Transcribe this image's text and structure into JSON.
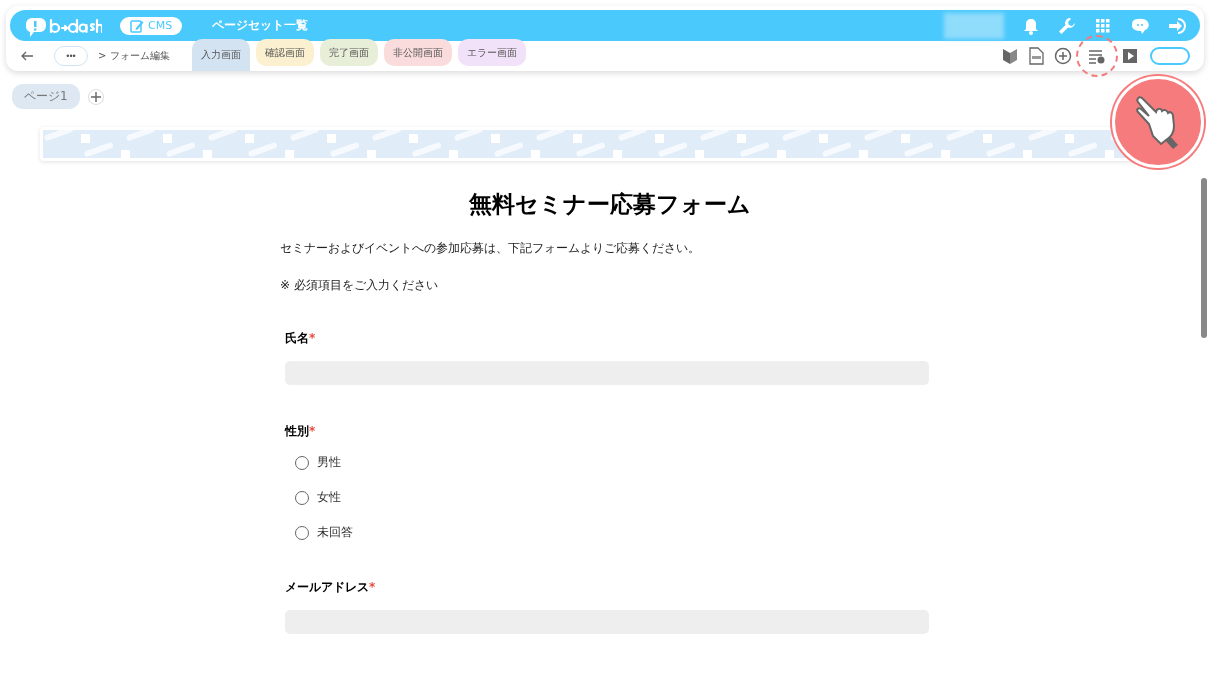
{
  "app_bar": {
    "product": "CMS",
    "title": "ページセット一覧"
  },
  "toolbar": {
    "more": "•••",
    "breadcrumb": "> フォーム編集",
    "tabs": [
      {
        "label": "入力画面",
        "selected": true,
        "color": "#d3e3f2"
      },
      {
        "label": "確認画面",
        "selected": false,
        "color": "#fbf0cf"
      },
      {
        "label": "完了画面",
        "selected": false,
        "color": "#e8efd9"
      },
      {
        "label": "非公開画面",
        "selected": false,
        "color": "#fbdcdc"
      },
      {
        "label": "エラー画面",
        "selected": false,
        "color": "#f2e2f9"
      }
    ]
  },
  "pages": [
    {
      "label": "ページ1",
      "selected": true
    }
  ],
  "form": {
    "title": "無料セミナー応募フォーム",
    "intro": "セミナーおよびイベントへの参加応募は、下記フォームよりご応募ください。",
    "note": "※ 必須項目をご入力ください",
    "fields": [
      {
        "kind": "text",
        "label": "氏名",
        "required_mark": "*"
      },
      {
        "kind": "radio",
        "label": "性別",
        "required_mark": "*",
        "options": [
          {
            "label": "男性",
            "selected": false
          },
          {
            "label": "女性",
            "selected": false
          },
          {
            "label": "未回答",
            "selected": false
          }
        ]
      },
      {
        "kind": "text",
        "label": "メールアドレス",
        "required_mark": "*"
      }
    ]
  }
}
